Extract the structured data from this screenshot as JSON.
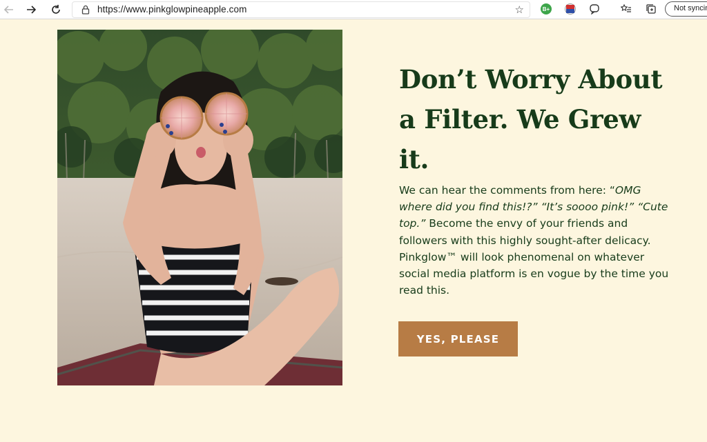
{
  "browser": {
    "url": "https://www.pinkglowpineapple.com",
    "sync_label": "Not syncing",
    "extensions": [
      {
        "name": "grammar-extension",
        "label": "B+",
        "color": "#3da54a"
      },
      {
        "name": "flag-extension",
        "label": "",
        "color": "#c83a3a"
      }
    ]
  },
  "hero": {
    "headline": [
      "Don’t Worry About",
      "a Filter. We Grew",
      "it."
    ],
    "body": {
      "l1": "We can hear the comments from here: “",
      "l1_em": "OMG",
      "l2_em": "where did you find this!?” “It’s soooo pink!” “Cute",
      "l3_em": "top.”",
      "l3": " Become the envy of your friends and",
      "l4": "followers with this highly sought-after delicacy.",
      "l5": "Pinkglow™ will look phenomenal on whatever",
      "l6": "social media platform is en vogue by the time you",
      "l7": "read this."
    },
    "cta_label": "YES, PLEASE"
  },
  "colors": {
    "page_bg": "#fdf6df",
    "headline": "#173b1a",
    "cta_bg": "#b77c45"
  }
}
